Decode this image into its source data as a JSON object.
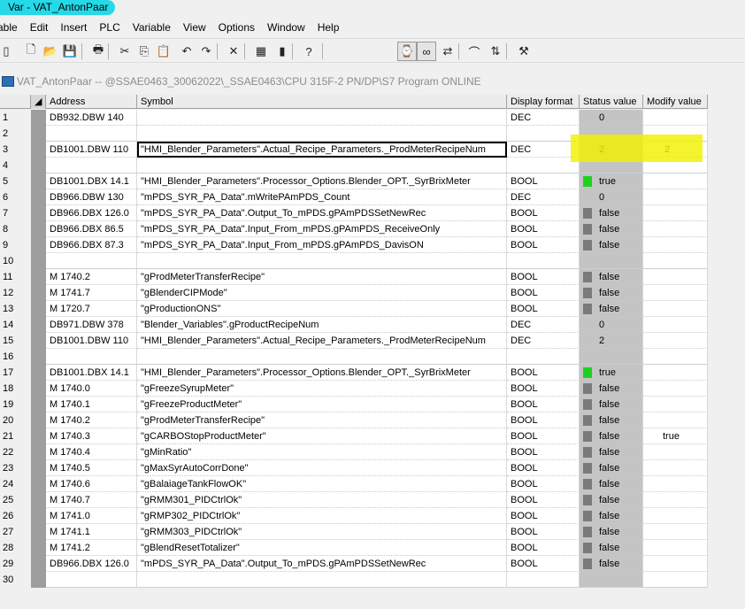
{
  "window": {
    "title": "Var - VAT_AntonPaar"
  },
  "menu": [
    "able",
    "Edit",
    "Insert",
    "PLC",
    "Variable",
    "View",
    "Options",
    "Window",
    "Help"
  ],
  "toolbar": {
    "buttons": [
      {
        "name": "open-table-icon",
        "glyph": "▯"
      },
      {
        "name": "new-icon",
        "glyph": "🗋"
      },
      {
        "name": "open-icon",
        "glyph": "📂"
      },
      {
        "name": "save-icon",
        "glyph": "💾"
      },
      {
        "name": "print-icon",
        "glyph": "🖶"
      },
      {
        "name": "cut-icon",
        "glyph": "✂"
      },
      {
        "name": "copy-icon",
        "glyph": "⎘"
      },
      {
        "name": "paste-icon",
        "glyph": "📋"
      },
      {
        "name": "undo-icon",
        "glyph": "↶"
      },
      {
        "name": "redo-icon",
        "glyph": "↷"
      },
      {
        "name": "delete-icon",
        "glyph": "✕"
      },
      {
        "name": "monitor-icon",
        "glyph": "▦"
      },
      {
        "name": "plc-icon",
        "glyph": "▮"
      },
      {
        "name": "help-icon",
        "glyph": "?"
      },
      {
        "name": "monitor-variable-icon",
        "glyph": "⌚"
      },
      {
        "name": "glasses-icon",
        "glyph": "∞"
      },
      {
        "name": "modify-icon",
        "glyph": "⇄"
      },
      {
        "name": "trigger-icon",
        "glyph": "⌒"
      },
      {
        "name": "activate-modify-icon",
        "glyph": "⇅"
      },
      {
        "name": "force-icon",
        "glyph": "⚒"
      }
    ]
  },
  "table_window": {
    "title": "VAT_AntonPaar -- @SSAE0463_30062022\\_SSAE0463\\CPU 315F-2 PN/DP\\S7 Program  ONLINE"
  },
  "table": {
    "columns": [
      "Address",
      "Symbol",
      "Display format",
      "Status value",
      "Modify value"
    ],
    "rows": [
      {
        "n": "1",
        "addr": "DB932.DBW  140",
        "sym": "",
        "fmt": "DEC",
        "status": "0",
        "ind": "",
        "mod": ""
      },
      {
        "n": "2",
        "addr": "",
        "sym": "",
        "fmt": "",
        "status": "",
        "ind": "",
        "mod": ""
      },
      {
        "n": "3",
        "addr": "DB1001.DBW  110",
        "sym": "\"HMI_Blender_Parameters\".Actual_Recipe_Parameters._ProdMeterRecipeNum",
        "fmt": "DEC",
        "status": "2",
        "ind": "",
        "mod": "2",
        "selected": true
      },
      {
        "n": "4",
        "addr": "",
        "sym": "",
        "fmt": "",
        "status": "",
        "ind": "",
        "mod": ""
      },
      {
        "n": "5",
        "addr": "DB1001.DBX   14.1",
        "sym": "\"HMI_Blender_Parameters\".Processor_Options.Blender_OPT._SyrBrixMeter",
        "fmt": "BOOL",
        "status": "true",
        "ind": "on",
        "mod": ""
      },
      {
        "n": "6",
        "addr": "DB966.DBW  130",
        "sym": "\"mPDS_SYR_PA_Data\".mWritePAmPDS_Count",
        "fmt": "DEC",
        "status": "0",
        "ind": "",
        "mod": ""
      },
      {
        "n": "7",
        "addr": "DB966.DBX  126.0",
        "sym": "\"mPDS_SYR_PA_Data\".Output_To_mPDS.gPAmPDSSetNewRec",
        "fmt": "BOOL",
        "status": "false",
        "ind": "off",
        "mod": ""
      },
      {
        "n": "8",
        "addr": "DB966.DBX   86.5",
        "sym": "\"mPDS_SYR_PA_Data\".Input_From_mPDS.gPAmPDS_ReceiveOnly",
        "fmt": "BOOL",
        "status": "false",
        "ind": "off",
        "mod": ""
      },
      {
        "n": "9",
        "addr": "DB966.DBX   87.3",
        "sym": "\"mPDS_SYR_PA_Data\".Input_From_mPDS.gPAmPDS_DavisON",
        "fmt": "BOOL",
        "status": "false",
        "ind": "off",
        "mod": ""
      },
      {
        "n": "10",
        "addr": "",
        "sym": "",
        "fmt": "",
        "status": "",
        "ind": "",
        "mod": ""
      },
      {
        "n": "11",
        "addr": "M   1740.2",
        "sym": "\"gProdMeterTransferRecipe\"",
        "fmt": "BOOL",
        "status": "false",
        "ind": "off",
        "mod": ""
      },
      {
        "n": "12",
        "addr": "M   1741.7",
        "sym": "\"gBlenderCIPMode\"",
        "fmt": "BOOL",
        "status": "false",
        "ind": "off",
        "mod": ""
      },
      {
        "n": "13",
        "addr": "M   1720.7",
        "sym": "\"gProductionONS\"",
        "fmt": "BOOL",
        "status": "false",
        "ind": "off",
        "mod": ""
      },
      {
        "n": "14",
        "addr": "DB971.DBW  378",
        "sym": "\"Blender_Variables\".gProductRecipeNum",
        "fmt": "DEC",
        "status": "0",
        "ind": "",
        "mod": ""
      },
      {
        "n": "15",
        "addr": "DB1001.DBW  110",
        "sym": "\"HMI_Blender_Parameters\".Actual_Recipe_Parameters._ProdMeterRecipeNum",
        "fmt": "DEC",
        "status": "2",
        "ind": "",
        "mod": ""
      },
      {
        "n": "16",
        "addr": "",
        "sym": "",
        "fmt": "",
        "status": "",
        "ind": "",
        "mod": ""
      },
      {
        "n": "17",
        "addr": "DB1001.DBX   14.1",
        "sym": "\"HMI_Blender_Parameters\".Processor_Options.Blender_OPT._SyrBrixMeter",
        "fmt": "BOOL",
        "status": "true",
        "ind": "on",
        "mod": ""
      },
      {
        "n": "18",
        "addr": "M   1740.0",
        "sym": "\"gFreezeSyrupMeter\"",
        "fmt": "BOOL",
        "status": "false",
        "ind": "off",
        "mod": ""
      },
      {
        "n": "19",
        "addr": "M   1740.1",
        "sym": "\"gFreezeProductMeter\"",
        "fmt": "BOOL",
        "status": "false",
        "ind": "off",
        "mod": ""
      },
      {
        "n": "20",
        "addr": "M   1740.2",
        "sym": "\"gProdMeterTransferRecipe\"",
        "fmt": "BOOL",
        "status": "false",
        "ind": "off",
        "mod": ""
      },
      {
        "n": "21",
        "addr": "M   1740.3",
        "sym": "\"gCARBOStopProductMeter\"",
        "fmt": "BOOL",
        "status": "false",
        "ind": "off",
        "mod": "true"
      },
      {
        "n": "22",
        "addr": "M   1740.4",
        "sym": "\"gMinRatio\"",
        "fmt": "BOOL",
        "status": "false",
        "ind": "off",
        "mod": ""
      },
      {
        "n": "23",
        "addr": "M   1740.5",
        "sym": "\"gMaxSyrAutoCorrDone\"",
        "fmt": "BOOL",
        "status": "false",
        "ind": "off",
        "mod": ""
      },
      {
        "n": "24",
        "addr": "M   1740.6",
        "sym": "\"gBalaiageTankFlowOK\"",
        "fmt": "BOOL",
        "status": "false",
        "ind": "off",
        "mod": ""
      },
      {
        "n": "25",
        "addr": "M   1740.7",
        "sym": "\"gRMM301_PIDCtrlOk\"",
        "fmt": "BOOL",
        "status": "false",
        "ind": "off",
        "mod": ""
      },
      {
        "n": "26",
        "addr": "M   1741.0",
        "sym": "\"gRMP302_PIDCtrlOk\"",
        "fmt": "BOOL",
        "status": "false",
        "ind": "off",
        "mod": ""
      },
      {
        "n": "27",
        "addr": "M   1741.1",
        "sym": "\"gRMM303_PIDCtrlOk\"",
        "fmt": "BOOL",
        "status": "false",
        "ind": "off",
        "mod": ""
      },
      {
        "n": "28",
        "addr": "M   1741.2",
        "sym": "\"gBlendResetTotalizer\"",
        "fmt": "BOOL",
        "status": "false",
        "ind": "off",
        "mod": ""
      },
      {
        "n": "29",
        "addr": "DB966.DBX  126.0",
        "sym": "\"mPDS_SYR_PA_Data\".Output_To_mPDS.gPAmPDSSetNewRec",
        "fmt": "BOOL",
        "status": "false",
        "ind": "off",
        "mod": ""
      },
      {
        "n": "30",
        "addr": "",
        "sym": "",
        "fmt": "",
        "status": "",
        "ind": "",
        "mod": ""
      }
    ]
  },
  "colors": {
    "title_highlight": "#25d9e8",
    "status_column": "#c4c4c4",
    "indicator_true": "#1fd11f",
    "indicator_false": "#7a7a7a",
    "annotation_highlight": "#f2f200"
  }
}
